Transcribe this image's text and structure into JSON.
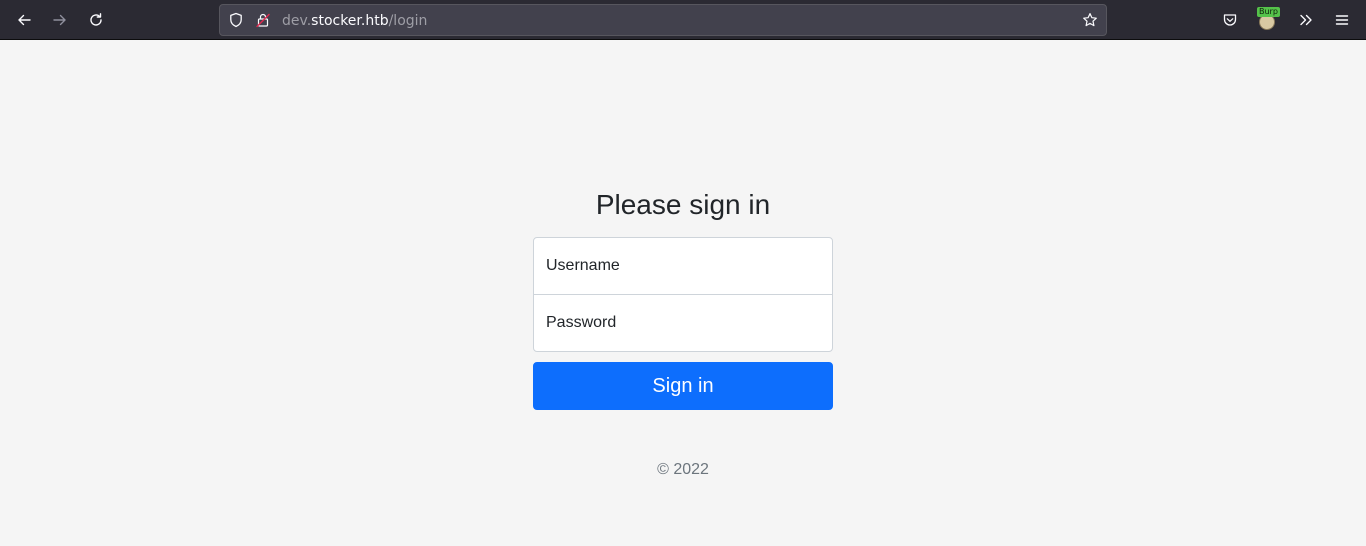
{
  "browser": {
    "url_prefix": "dev.",
    "url_host": "stocker.htb",
    "url_path": "/login",
    "extension_badge": "Burp",
    "icons": {
      "back": "arrow-left-icon",
      "forward": "arrow-right-icon",
      "reload": "reload-icon",
      "tracking": "shield-icon",
      "connection": "insecure-lock-icon",
      "bookmark": "star-icon",
      "pocket": "pocket-icon",
      "overflow": "chevron-double-right-icon",
      "menu": "hamburger-menu-icon"
    },
    "colors": {
      "toolbar": "#2b2a33",
      "urlbar": "#42414d"
    }
  },
  "page": {
    "heading": "Please sign in",
    "username_placeholder": "Username",
    "password_placeholder": "Password",
    "submit_label": "Sign in",
    "footer": "© 2022",
    "colors": {
      "background": "#f5f5f5",
      "primary_button": "#0d6efd",
      "muted_text": "#6c757d"
    }
  }
}
